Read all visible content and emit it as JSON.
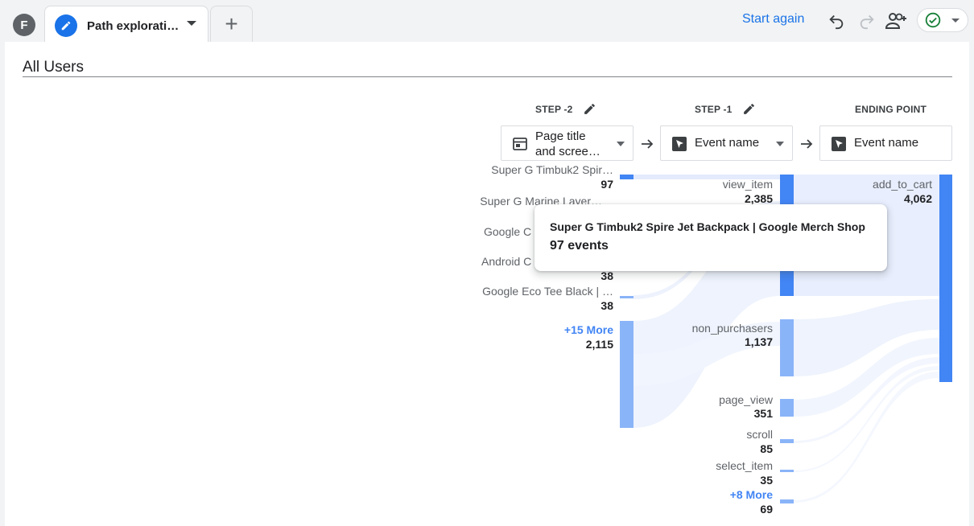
{
  "header": {
    "avatar_letter": "F",
    "tab_label": "Path explorati…",
    "add_tab_symbol": "+",
    "start_again_label": "Start again"
  },
  "segment": {
    "title": "All Users"
  },
  "steps": [
    {
      "header": "STEP -2",
      "dropdown_label": [
        "Page title",
        "and scree…"
      ],
      "dropdown_icon": "page-icon"
    },
    {
      "header": "STEP -1",
      "dropdown_label": [
        "Event name"
      ],
      "dropdown_icon": "cursor-icon"
    },
    {
      "header": "ENDING POINT",
      "dropdown_label": [
        "Event name"
      ],
      "dropdown_icon": "cursor-icon"
    }
  ],
  "step2_nodes": [
    {
      "label": "Super G Timbuk2 Spir…",
      "value": "97"
    },
    {
      "label": "Super G Marine Layer…",
      "value": ""
    },
    {
      "label": "Google C",
      "value": ""
    },
    {
      "label": "Android C",
      "value": "38"
    },
    {
      "label": "Google Eco Tee Black | …",
      "value": "38"
    },
    {
      "label": "+15 More",
      "value": "2,115"
    }
  ],
  "step1_nodes": [
    {
      "label": "view_item",
      "value": "2,385"
    },
    {
      "label": "non_purchasers",
      "value": "1,137"
    },
    {
      "label": "page_view",
      "value": "351"
    },
    {
      "label": "scroll",
      "value": "85"
    },
    {
      "label": "select_item",
      "value": "35"
    },
    {
      "label": "+8 More",
      "value": "69"
    }
  ],
  "ending_nodes": [
    {
      "label": "add_to_cart",
      "value": "4,062"
    }
  ],
  "tooltip": {
    "title": "Super G Timbuk2 Spire Jet Backpack | Google Merch Shop",
    "value": "97 events"
  },
  "colors": {
    "accent": "#1a73e8",
    "bar_dark": "#4285f4",
    "bar_light": "#8ab4f8",
    "flow": "#e8f0fe"
  }
}
